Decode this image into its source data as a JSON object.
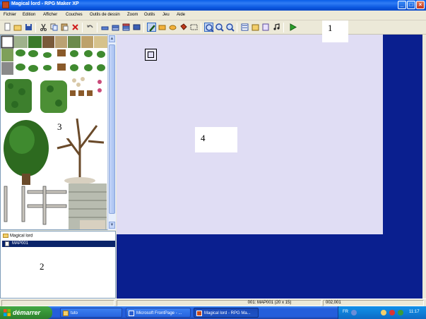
{
  "window": {
    "title": "Magical lord - RPG Maker XP",
    "buttons": {
      "minimize": "_",
      "maximize": "□",
      "close": "×"
    }
  },
  "menu": [
    "Fichier",
    "Edition",
    "Afficher",
    "Couches",
    "Outils de dessin",
    "Zoom",
    "Outils",
    "Jeu",
    "Aide"
  ],
  "toolbar": {
    "icons": [
      "new-project-icon",
      "open-project-icon",
      "save-icon",
      "cut-icon",
      "copy-icon",
      "paste-icon",
      "delete-icon",
      "undo-icon",
      "layer-1-icon",
      "layer-2-icon",
      "layer-3-icon",
      "events-layer-icon",
      "pencil-icon",
      "rectangle-icon",
      "ellipse-icon",
      "fill-icon",
      "select-icon",
      "zoom-1-icon",
      "zoom-2-icon",
      "zoom-4-icon",
      "database-icon",
      "materials-icon",
      "script-editor-icon",
      "sound-test-icon",
      "playtest-icon"
    ]
  },
  "annotations": {
    "a1": "1",
    "a2": "2",
    "a3": "3",
    "a4": "4"
  },
  "map_tree": {
    "root": "Magical lord",
    "selected_map": "MAP001"
  },
  "status": {
    "map_info": "001: MAP001 (20 x 15)",
    "coords": "002,001"
  },
  "taskbar": {
    "start_label": "démarrer",
    "tasks": [
      {
        "label": "tuto"
      },
      {
        "label": "Microsoft FrontPage - ..."
      },
      {
        "label": "Magical lord - RPG Ma..."
      }
    ],
    "tray": {
      "lang": "FR",
      "time": "11:17"
    }
  },
  "colors": {
    "map_background": "#0a1f8f",
    "map_canvas": "#e0ddf4",
    "selection": "#0a246a"
  }
}
